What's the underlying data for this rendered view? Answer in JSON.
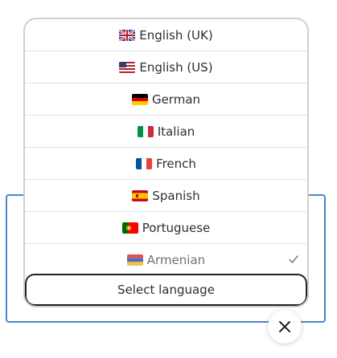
{
  "languages": [
    {
      "label": "English (UK)",
      "flag": "uk-flag"
    },
    {
      "label": "English (US)",
      "flag": "us-flag"
    },
    {
      "label": "German",
      "flag": "de-flag"
    },
    {
      "label": "Italian",
      "flag": "it-flag"
    },
    {
      "label": "French",
      "flag": "fr-flag"
    },
    {
      "label": "Spanish",
      "flag": "es-flag"
    },
    {
      "label": "Portuguese",
      "flag": "pt-flag"
    },
    {
      "label": "Armenian",
      "flag": "am-flag",
      "selected": true
    }
  ],
  "select_label": "Select language",
  "colors": {
    "accent_border": "#4a86cc",
    "text": "#2b2f36",
    "selected_text": "#6d727a"
  }
}
